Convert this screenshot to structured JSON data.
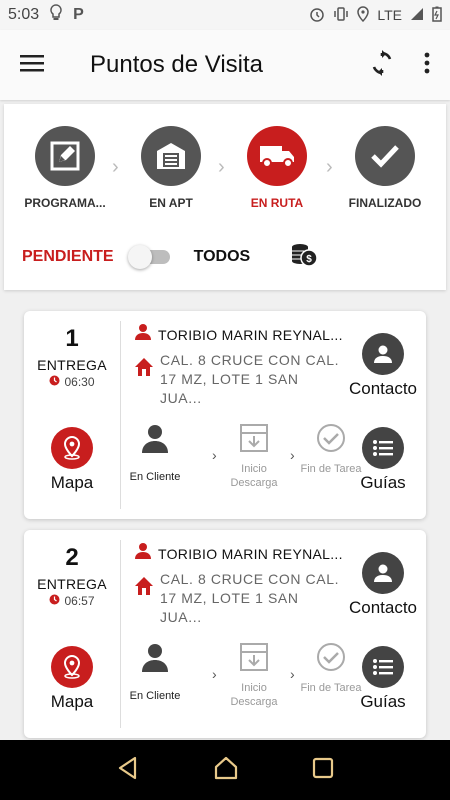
{
  "status_bar": {
    "time": "5:03",
    "network": "LTE"
  },
  "app_bar": {
    "title": "Puntos de Visita"
  },
  "steps": [
    {
      "label": "PROGRAMA...",
      "icon": "edit-icon",
      "active": false
    },
    {
      "label": "EN APT",
      "icon": "warehouse-icon",
      "active": false
    },
    {
      "label": "EN RUTA",
      "icon": "truck-icon",
      "active": true
    },
    {
      "label": "FINALIZADO",
      "icon": "check-icon",
      "active": false
    }
  ],
  "filter": {
    "pending_label": "PENDIENTE",
    "all_label": "TODOS",
    "toggle_on": false
  },
  "visits": [
    {
      "number": "1",
      "type": "ENTREGA",
      "time": "06:30",
      "client": "TORIBIO MARIN REYNAL...",
      "address": "CAL. 8 CRUCE CON CAL. 17 MZ, LOTE 1 SAN JUA...",
      "map_label": "Mapa",
      "contact_label": "Contacto",
      "guides_label": "Guías",
      "progress": {
        "step1": "En Cliente",
        "step2": "Inicio Descarga",
        "step3": "Fin de Tarea"
      }
    },
    {
      "number": "2",
      "type": "ENTREGA",
      "time": "06:57",
      "client": "TORIBIO MARIN REYNAL...",
      "address": "CAL. 8 CRUCE CON CAL. 17 MZ, LOTE 1 SAN JUA...",
      "map_label": "Mapa",
      "contact_label": "Contacto",
      "guides_label": "Guías",
      "progress": {
        "step1": "En Cliente",
        "step2": "Inicio Descarga",
        "step3": "Fin de Tarea"
      }
    }
  ],
  "colors": {
    "accent": "#c81e1e",
    "dark": "#555555"
  }
}
